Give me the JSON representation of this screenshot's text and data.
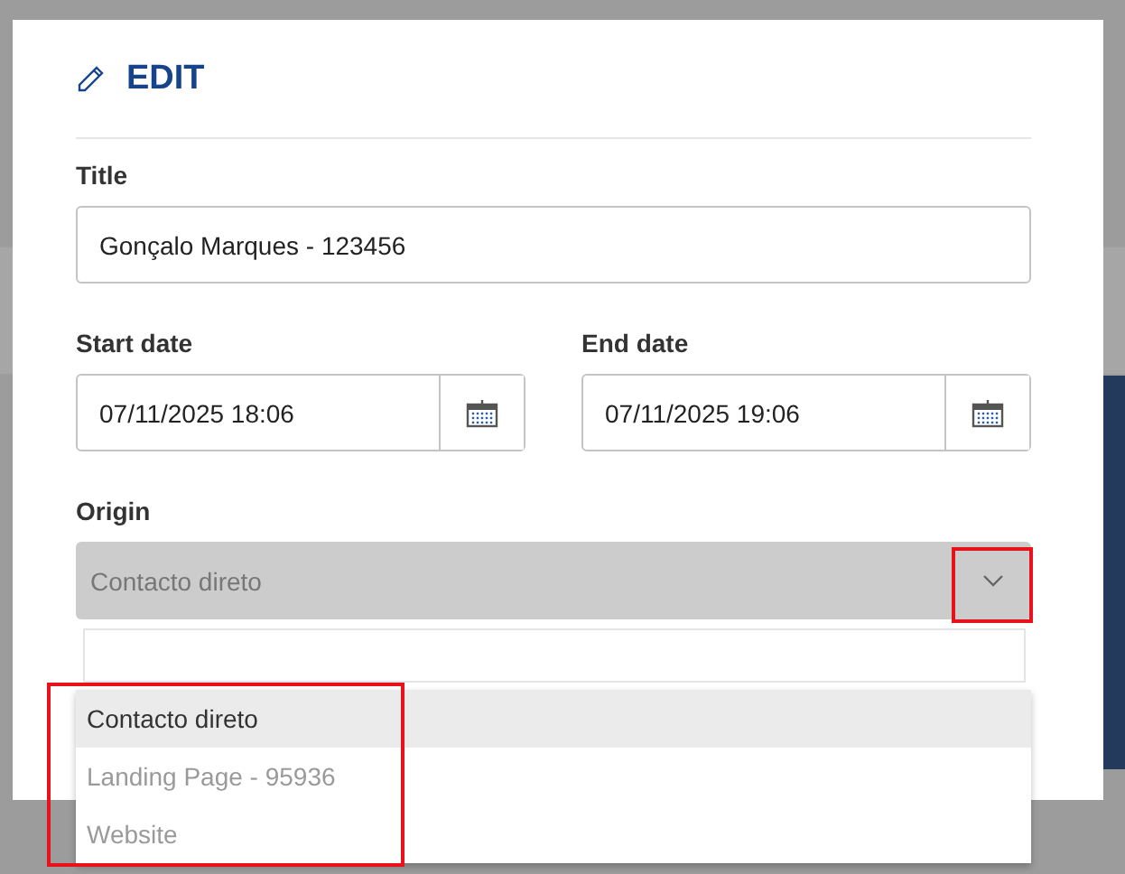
{
  "dialog": {
    "title": "EDIT"
  },
  "fields": [
    {
      "kind": "text",
      "label": "Title",
      "value": "Gonçalo Marques - 123456"
    }
  ],
  "dates": [
    {
      "label": "Start date",
      "value": "07/11/2025 18:06"
    },
    {
      "label": "End date",
      "value": "07/11/2025 19:06"
    }
  ],
  "origin": {
    "label": "Origin",
    "value": "Contacto direto",
    "expanded": true,
    "options": [
      {
        "label": "Contacto direto",
        "selected": true
      },
      {
        "label": "Landing Page - 95936",
        "selected": false
      },
      {
        "label": "Website",
        "selected": false
      }
    ]
  }
}
